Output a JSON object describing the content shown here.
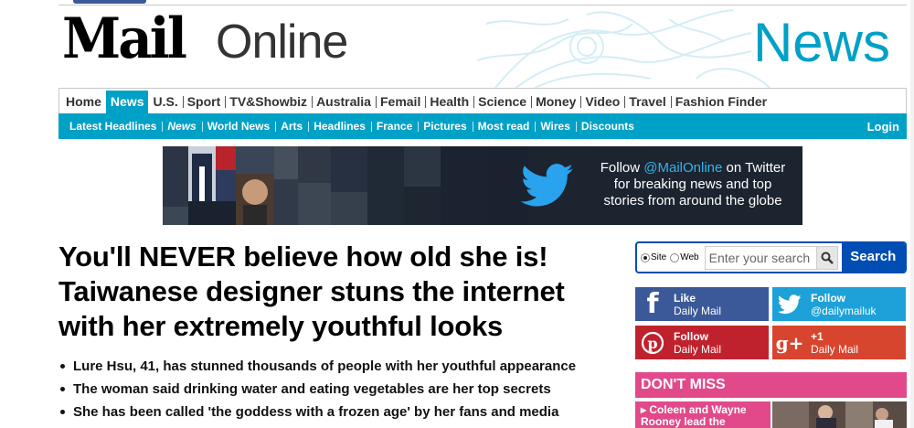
{
  "masthead": {
    "logo_mail": "Mail",
    "logo_online": "Online",
    "section_title": "News",
    "accent_color": "#00a1c6"
  },
  "nav_primary": [
    {
      "label": "Home",
      "active": false
    },
    {
      "label": "News",
      "active": true
    },
    {
      "label": "U.S.",
      "active": false
    },
    {
      "label": "Sport",
      "active": false
    },
    {
      "label": "TV&Showbiz",
      "active": false
    },
    {
      "label": "Australia",
      "active": false
    },
    {
      "label": "Femail",
      "active": false
    },
    {
      "label": "Health",
      "active": false
    },
    {
      "label": "Science",
      "active": false
    },
    {
      "label": "Money",
      "active": false
    },
    {
      "label": "Video",
      "active": false
    },
    {
      "label": "Travel",
      "active": false
    },
    {
      "label": "Fashion Finder",
      "active": false
    }
  ],
  "nav_secondary": [
    {
      "label": "Latest Headlines",
      "italic": false
    },
    {
      "label": "News",
      "italic": true
    },
    {
      "label": "World News",
      "italic": false
    },
    {
      "label": "Arts",
      "italic": false
    },
    {
      "label": "Headlines",
      "italic": false
    },
    {
      "label": "France",
      "italic": false
    },
    {
      "label": "Pictures",
      "italic": false
    },
    {
      "label": "Most read",
      "italic": false
    },
    {
      "label": "Wires",
      "italic": false
    },
    {
      "label": "Discounts",
      "italic": false
    }
  ],
  "login_label": "Login",
  "banner": {
    "line1_prefix": "Follow ",
    "handle": "@MailOnline",
    "line1_suffix": " on Twitter",
    "line2": "for breaking news and top",
    "line3": "stories from around the globe",
    "icon": "twitter-bird-icon"
  },
  "article": {
    "headline": "You'll NEVER believe how old she is! Taiwanese designer stuns the internet with her extremely youthful looks",
    "bullets": [
      "Lure Hsu, 41, has stunned thousands of people with her youthful appearance",
      "The woman said drinking water and eating vegetables are her top secrets",
      "She has been called 'the goddess with a frozen age' by her fans and media"
    ]
  },
  "search": {
    "radio_site": "Site",
    "radio_web": "Web",
    "selected": "Site",
    "placeholder": "Enter your search",
    "button_label": "Search",
    "icon": "magnifier-icon"
  },
  "social": {
    "facebook": {
      "action": "Like",
      "account": "Daily Mail",
      "icon": "facebook-icon",
      "color": "#3b5998"
    },
    "twitter": {
      "action": "Follow",
      "account": "@dailymailuk",
      "icon": "twitter-icon",
      "color": "#1da1d8"
    },
    "pinterest": {
      "action": "Follow",
      "account": "Daily Mail",
      "icon": "pinterest-icon",
      "color": "#c0222d"
    },
    "googleplus": {
      "action": "+1",
      "account": "Daily Mail",
      "icon": "google-plus-icon",
      "color": "#d8452e"
    }
  },
  "dont_miss": {
    "title": "DON'T MISS",
    "item_text": "Coleen and Wayne Rooney lead the",
    "color": "#e2498a"
  }
}
